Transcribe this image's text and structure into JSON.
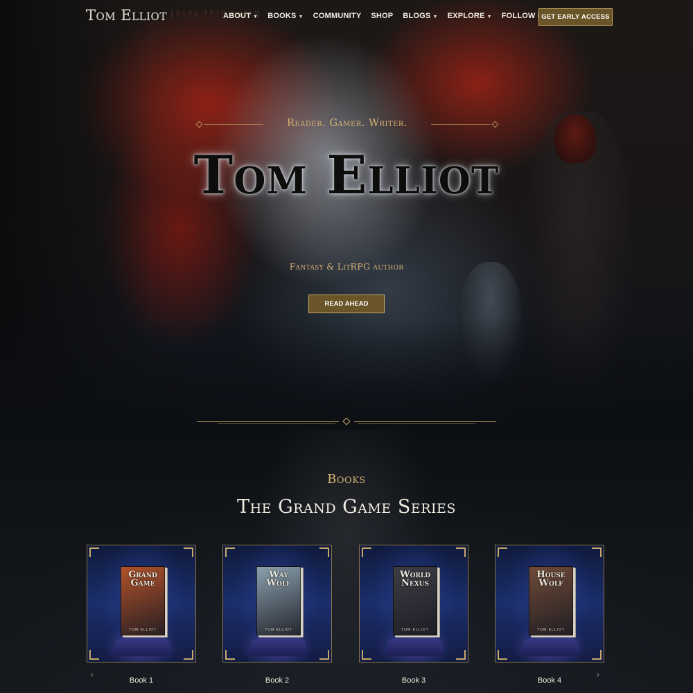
{
  "header": {
    "logo": "Tom Elliot",
    "nav": [
      {
        "label": "ABOUT",
        "dropdown": true
      },
      {
        "label": "BOOKS",
        "dropdown": true
      },
      {
        "label": "COMMUNITY",
        "dropdown": false
      },
      {
        "label": "SHOP",
        "dropdown": false
      },
      {
        "label": "BLOGS",
        "dropdown": true
      },
      {
        "label": "EXPLORE",
        "dropdown": true
      },
      {
        "label": "FOLLOW ME",
        "dropdown": true
      }
    ],
    "cta": "GET EARLY ACCESS"
  },
  "hero": {
    "tagline": "Reader. Gamer. Writer.",
    "title": "Tom Elliot",
    "subtitle": "Fantasy & LitRPG author",
    "cta": "READ AHEAD"
  },
  "books": {
    "kicker": "Books",
    "series_title": "The Grand Game Series",
    "items": [
      {
        "label": "Book 1",
        "cover_title": "Grand\nGame",
        "cover_author": "TOM ELLIOT",
        "cover_color": "#b2522a"
      },
      {
        "label": "Book 2",
        "cover_title": "Way\nWolf",
        "cover_author": "TOM ELLIOT",
        "cover_color": "#8aa0ad"
      },
      {
        "label": "Book 3",
        "cover_title": "World\nNexus",
        "cover_author": "TOM ELLIOT",
        "cover_color": "#3d3e44"
      },
      {
        "label": "Book 4",
        "cover_title": "House\nWolf",
        "cover_author": "TOM ELLIOT",
        "cover_color": "#6f4a36"
      }
    ],
    "prev_icon": "chevron-left-icon",
    "next_icon": "chevron-right-icon"
  },
  "colors": {
    "accent_gold": "#d4b173",
    "button_bg": "#6a5528",
    "button_border": "#c7a865"
  }
}
